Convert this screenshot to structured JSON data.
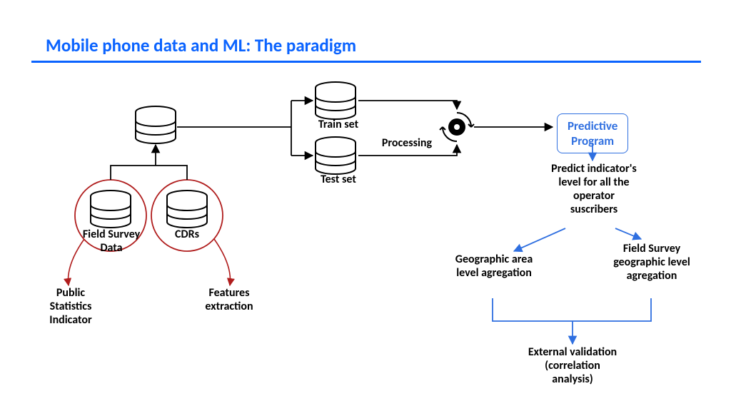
{
  "slide": {
    "title": "Mobile phone data and ML: The paradigm"
  },
  "nodes": {
    "field_survey": "Field Survey\nData",
    "cdrs": "CDRs",
    "train_set": "Train set",
    "test_set": "Test set",
    "processing": "Processing",
    "predictive_program": "Predictive\nProgram",
    "public_stats": "Public\nStatistics\nIndicator",
    "features": "Features\nextraction",
    "predict_level": "Predict indicator's\nlevel for all the\noperator\nsuscribers",
    "geo_area": "Geographic area\nlevel agregation",
    "fs_geo": "Field Survey\ngeographic level\nagregation",
    "external_validation": "External validation\n(correlation\nanalysis)"
  },
  "colors": {
    "accent": "#0a63ff",
    "box_blue": "#2f6fe0",
    "red": "#b01d1d",
    "black": "#000000"
  }
}
